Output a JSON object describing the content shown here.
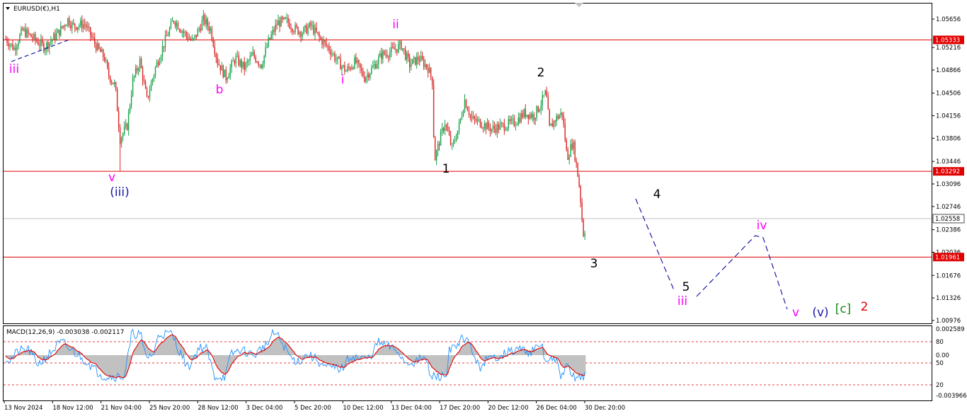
{
  "header": {
    "symbol_title": "EURUSD(€),H1",
    "collapse_icon": "triangle-down-icon"
  },
  "indicator": {
    "title": "MACD(12,26,9) -0.003038 -0.002117"
  },
  "colors": {
    "bull_candle": "#16a34a",
    "bear_candle": "#dc2626",
    "level_line": "#e00000",
    "current_line": "#c0c0c0",
    "projection": "#1a1aa6",
    "macd_hist": "#c0c0c0",
    "macd_line": "#1e90ff",
    "signal_line": "#e00000",
    "magenta": "#ff00ff",
    "navy": "#1a1aa6",
    "green": "#1a8a1a",
    "red": "#e00000"
  },
  "chart_data": [
    {
      "type": "candlestick",
      "symbol": "EURUSD",
      "timeframe": "H1",
      "ylim": [
        1.00976,
        1.05656
      ],
      "y_ticks": [
        "1.05656",
        "1.05216",
        "1.04866",
        "1.04506",
        "1.04156",
        "1.03806",
        "1.03446",
        "1.03096",
        "1.02746",
        "1.02386",
        "1.02036",
        "1.01676",
        "1.01326",
        "1.00976"
      ],
      "x_ticks": [
        "13 Nov 2024",
        "18 Nov 12:00",
        "21 Nov 04:00",
        "25 Nov 20:00",
        "28 Nov 12:00",
        "3 Dec 04:00",
        "5 Dec 20:00",
        "10 Dec 12:00",
        "13 Dec 04:00",
        "17 Dec 20:00",
        "20 Dec 12:00",
        "26 Dec 04:00",
        "30 Dec 20:00"
      ],
      "horizontal_levels": [
        {
          "value": 1.05333,
          "label": "1.05333"
        },
        {
          "value": 1.03292,
          "label": "1.03292"
        },
        {
          "value": 1.01961,
          "label": "1.01961"
        }
      ],
      "current_price": {
        "value": 1.02558,
        "label": "1.02558"
      },
      "price_path": [
        [
          0,
          1.0535
        ],
        [
          12,
          1.052
        ],
        [
          24,
          1.0548
        ],
        [
          40,
          1.0535
        ],
        [
          55,
          1.0522
        ],
        [
          75,
          1.0545
        ],
        [
          88,
          1.0565
        ],
        [
          95,
          1.0555
        ],
        [
          112,
          1.0558
        ],
        [
          118,
          1.0545
        ],
        [
          130,
          1.052
        ],
        [
          140,
          1.0505
        ],
        [
          145,
          1.048
        ],
        [
          155,
          1.0462
        ],
        [
          162,
          1.038
        ],
        [
          172,
          1.04
        ],
        [
          180,
          1.047
        ],
        [
          190,
          1.05
        ],
        [
          200,
          1.044
        ],
        [
          212,
          1.049
        ],
        [
          225,
          1.053
        ],
        [
          238,
          1.0565
        ],
        [
          252,
          1.0545
        ],
        [
          265,
          1.053
        ],
        [
          280,
          1.0565
        ],
        [
          290,
          1.055
        ],
        [
          300,
          1.05
        ],
        [
          312,
          1.0475
        ],
        [
          325,
          1.0505
        ],
        [
          338,
          1.049
        ],
        [
          350,
          1.051
        ],
        [
          362,
          1.0495
        ],
        [
          372,
          1.053
        ],
        [
          385,
          1.056
        ],
        [
          398,
          1.0562
        ],
        [
          410,
          1.055
        ],
        [
          420,
          1.0545
        ],
        [
          432,
          1.0555
        ],
        [
          445,
          1.0535
        ],
        [
          458,
          1.052
        ],
        [
          470,
          1.05
        ],
        [
          482,
          1.0485
        ],
        [
          495,
          1.05
        ],
        [
          508,
          1.0475
        ],
        [
          520,
          1.049
        ],
        [
          532,
          1.051
        ],
        [
          545,
          1.0515
        ],
        [
          560,
          1.0525
        ],
        [
          572,
          1.0495
        ],
        [
          585,
          1.0505
        ],
        [
          598,
          1.049
        ],
        [
          604,
          1.047
        ],
        [
          607,
          1.0345
        ],
        [
          615,
          1.038
        ],
        [
          622,
          1.0405
        ],
        [
          632,
          1.0365
        ],
        [
          642,
          1.04
        ],
        [
          650,
          1.044
        ],
        [
          660,
          1.041
        ],
        [
          672,
          1.0405
        ],
        [
          688,
          1.0395
        ],
        [
          705,
          1.04
        ],
        [
          720,
          1.0405
        ],
        [
          735,
          1.042
        ],
        [
          748,
          1.0415
        ],
        [
          758,
          1.0435
        ],
        [
          765,
          1.0452
        ],
        [
          770,
          1.0395
        ],
        [
          778,
          1.041
        ],
        [
          788,
          1.042
        ],
        [
          795,
          1.035
        ],
        [
          803,
          1.0375
        ],
        [
          808,
          1.034
        ],
        [
          813,
          1.03
        ],
        [
          816,
          1.0255
        ],
        [
          819,
          1.0222
        ],
        [
          821,
          1.0256
        ]
      ],
      "notable_lows": [
        {
          "x_index": 162,
          "value": 1.03292
        },
        {
          "x_index": 819,
          "value": 1.0222
        }
      ],
      "wave_labels": [
        {
          "text": "iii",
          "color": "magenta",
          "at": [
            20,
            103
          ]
        },
        {
          "text": "v",
          "color": "magenta",
          "at": [
            158,
            256
          ]
        },
        {
          "text": "(iii)",
          "color": "navy",
          "at": [
            169,
            277
          ]
        },
        {
          "text": "b",
          "color": "magenta",
          "at": [
            310,
            132
          ]
        },
        {
          "text": "i",
          "color": "magenta",
          "at": [
            484,
            118
          ]
        },
        {
          "text": "ii",
          "color": "magenta",
          "at": [
            559,
            40
          ]
        },
        {
          "text": "1",
          "color": "black",
          "at": [
            630,
            244
          ]
        },
        {
          "text": "2",
          "color": "black",
          "at": [
            764,
            108
          ]
        },
        {
          "text": "3",
          "color": "black",
          "at": [
            839,
            378
          ]
        },
        {
          "text": "4",
          "color": "black",
          "at": [
            928,
            280
          ]
        },
        {
          "text": "5",
          "color": "black",
          "at": [
            969,
            411
          ]
        },
        {
          "text": "iii",
          "color": "magenta",
          "at": [
            964,
            431
          ]
        },
        {
          "text": "iv",
          "color": "magenta",
          "at": [
            1076,
            324
          ]
        },
        {
          "text": "v",
          "color": "magenta",
          "at": [
            1124,
            447
          ]
        },
        {
          "text": "(v)",
          "color": "navy",
          "at": [
            1159,
            447
          ]
        },
        {
          "text": "[c]",
          "color": "green",
          "at": [
            1191,
            442
          ]
        },
        {
          "text": "2",
          "color": "red",
          "at": [
            1221,
            439
          ]
        }
      ]
    },
    {
      "type": "line",
      "indicator": "MACD(12,26,9)",
      "values": {
        "macd": -0.003038,
        "signal": -0.002117
      },
      "y_ticks": [
        "0.002589",
        "80",
        "0.00",
        "50",
        "20",
        "-0.003966"
      ],
      "ylim": [
        -0.003966,
        0.002589
      ]
    }
  ]
}
